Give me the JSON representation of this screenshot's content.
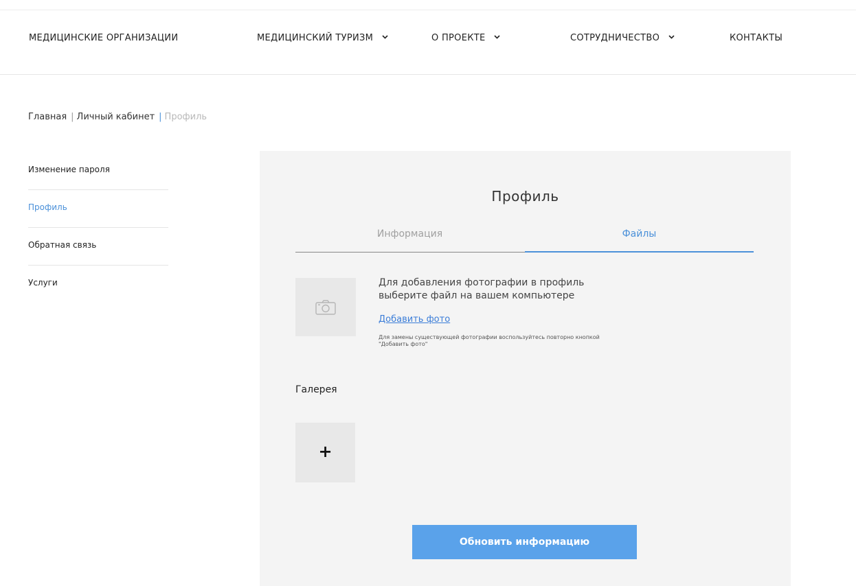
{
  "nav": {
    "items": [
      {
        "label": "МЕДИЦИНСКИЕ ОРГАНИЗАЦИИ",
        "has_dropdown": false
      },
      {
        "label": "МЕДИЦИНСКИЙ ТУРИЗМ",
        "has_dropdown": true
      },
      {
        "label": "О ПРОЕКТЕ",
        "has_dropdown": true
      },
      {
        "label": "СОТРУДНИЧЕСТВО",
        "has_dropdown": true
      },
      {
        "label": "КОНТАКТЫ",
        "has_dropdown": false
      }
    ],
    "dropdown_icon": "chevron-down-icon"
  },
  "breadcrumb": {
    "home": "Главная",
    "cabinet": "Личный кабинет",
    "current": "Профиль",
    "separator": "|"
  },
  "sidebar": {
    "items": [
      {
        "label": "Изменение пароля",
        "active": false
      },
      {
        "label": "Профиль",
        "active": true
      },
      {
        "label": "Обратная связь",
        "active": false
      },
      {
        "label": "Услуги",
        "active": false
      }
    ]
  },
  "panel": {
    "title": "Профиль",
    "tabs": [
      {
        "label": "Информация",
        "active": false
      },
      {
        "label": "Файлы",
        "active": true
      }
    ],
    "photo": {
      "icon": "camera-icon",
      "text": "Для добавления фотографии в профиль выберите файл на вашем компьютере",
      "add_link": "Добавить фото",
      "hint": "Для замены существующей фотографии воспользуйтесь повторно кнопкой \"Добавить фото\""
    },
    "gallery": {
      "label": "Галерея",
      "add_symbol": "+"
    },
    "submit_label": "Обновить информацию"
  },
  "colors": {
    "accent": "#4a90d9",
    "button": "#5aa2ea",
    "panel_bg": "#f4f4f4",
    "placeholder_bg": "#e8e8e8"
  }
}
